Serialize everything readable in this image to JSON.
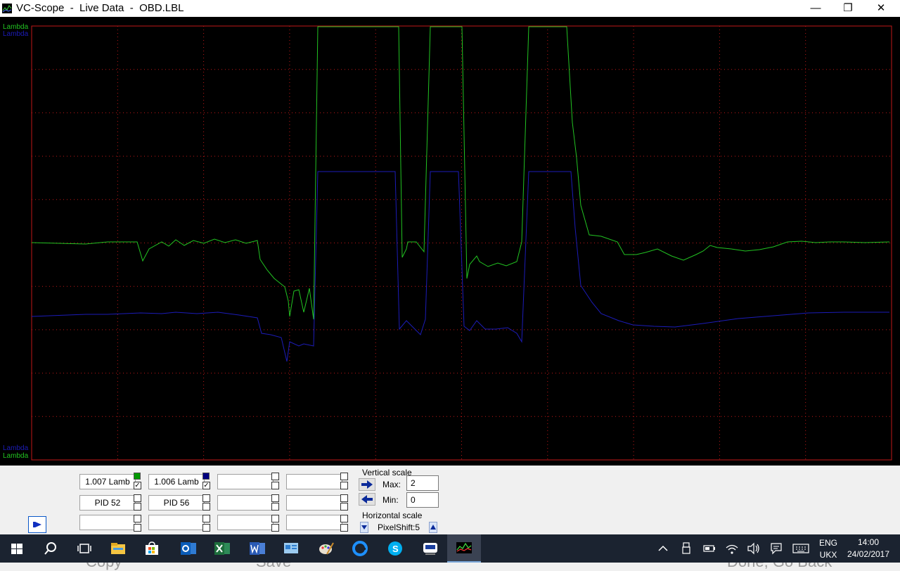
{
  "window": {
    "title": "VC-Scope  -  Live Data  -  OBD.LBL",
    "minimize_glyph": "—",
    "maximize_glyph": "❐",
    "close_glyph": "✕"
  },
  "scope": {
    "top_labels": [
      "Lambda",
      "Lambda"
    ],
    "bottom_labels": [
      "Lambda",
      "Lambda"
    ],
    "colors": {
      "series1": "#22c322",
      "series2": "#1c1cb8",
      "grid": "#c01818",
      "background": "#000000"
    }
  },
  "channels": [
    {
      "value": "1.007 Lamb",
      "pid": "PID 52",
      "color": "#009900",
      "checked": true
    },
    {
      "value": "1.006 Lamb",
      "pid": "PID 56",
      "color": "#00007f",
      "checked": true
    },
    {
      "value": "",
      "pid": "",
      "color": "",
      "checked": false
    },
    {
      "value": "",
      "pid": "",
      "color": "",
      "checked": false
    }
  ],
  "vertical_scale": {
    "label": "Vertical scale",
    "max_label": "Max:",
    "max_value": "2",
    "min_label": "Min:",
    "min_value": "0"
  },
  "horizontal_scale": {
    "label": "Horizontal scale",
    "value": "PixelShift:5"
  },
  "behind_window": [
    "Copy",
    "Save",
    "Done, Go Back"
  ],
  "taskbar": {
    "icons": [
      "windows-start-icon",
      "search-icon",
      "task-view-icon",
      "file-explorer-icon",
      "store-icon",
      "outlook-icon",
      "excel-icon",
      "word-icon",
      "control-panel-icon",
      "paint-icon",
      "edge-icon",
      "skype-icon",
      "vcds-icon",
      "vc-scope-icon"
    ],
    "lang_line1": "ENG",
    "lang_line2": "UKX",
    "time": "14:00",
    "date": "24/02/2017"
  }
}
